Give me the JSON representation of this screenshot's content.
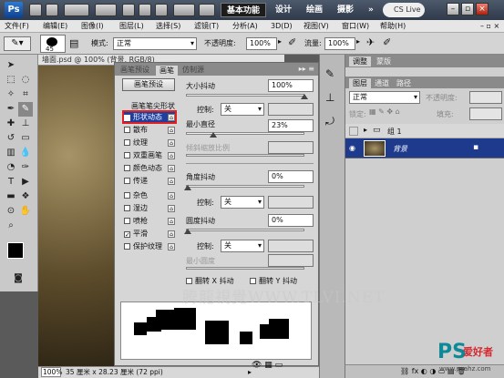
{
  "titlebar": {
    "app_icon": "Ps",
    "workspaces": [
      "基本功能",
      "设计",
      "绘画",
      "摄影"
    ],
    "active_workspace": 0,
    "more": "»",
    "cs_live": "CS Live"
  },
  "menubar": [
    "文件(F)",
    "编辑(E)",
    "图像(I)",
    "图层(L)",
    "选择(S)",
    "滤镜(T)",
    "分析(A)",
    "3D(D)",
    "视图(V)",
    "窗口(W)",
    "帮助(H)"
  ],
  "options": {
    "brush_size": "45",
    "mode_label": "模式:",
    "mode_value": "正常",
    "opacity_label": "不透明度:",
    "opacity_value": "100%",
    "flow_label": "流量:",
    "flow_value": "100%"
  },
  "document": {
    "tab_title": "墙面.psd @ 100% (背景, RGB/8)",
    "zoom": "100%",
    "doc_size": "35 厘米 x 28.23 厘米 (72 ppi)"
  },
  "brush_panel": {
    "tabs": [
      "画笔预设",
      "画笔",
      "仿制源"
    ],
    "active_tab": 1,
    "preset_button": "画笔预设",
    "tip_header": "画笔笔尖形状",
    "items": [
      {
        "label": "形状动态",
        "checked": true,
        "selected": true
      },
      {
        "label": "散布",
        "checked": false
      },
      {
        "label": "纹理",
        "checked": false
      },
      {
        "label": "双重画笔",
        "checked": false
      },
      {
        "label": "颜色动态",
        "checked": false
      },
      {
        "label": "传递",
        "checked": false
      },
      {
        "label": "杂色",
        "checked": false
      },
      {
        "label": "湿边",
        "checked": false
      },
      {
        "label": "喷枪",
        "checked": false
      },
      {
        "label": "平滑",
        "checked": true
      },
      {
        "label": "保护纹理",
        "checked": false
      }
    ],
    "size_jitter_label": "大小抖动",
    "size_jitter_value": "100%",
    "control_label": "控制:",
    "control_value": "关",
    "min_diameter_label": "最小直径",
    "min_diameter_value": "23%",
    "tilt_scale_label": "倾斜缩放比例",
    "angle_jitter_label": "角度抖动",
    "angle_jitter_value": "0%",
    "roundness_jitter_label": "圆度抖动",
    "roundness_jitter_value": "0%",
    "min_roundness_label": "最小圆度",
    "flip_x_label": "翻转 X 抖动",
    "flip_y_label": "翻转 Y 抖动"
  },
  "layers_panel": {
    "tabs_top": [
      "调整",
      "蒙版"
    ],
    "tabs": [
      "图层",
      "通道",
      "路径"
    ],
    "blend_mode": "正常",
    "opacity_label": "不透明度:",
    "lock_label": "锁定:",
    "fill_label": "填充:",
    "group_name": "组 1",
    "layer_name": "背景"
  },
  "watermark": "腾龍視覺WWW.TLVI.NET",
  "branding": {
    "ps": "PS",
    "site_cn": "爱好者",
    "url": "www.psahz.com"
  }
}
